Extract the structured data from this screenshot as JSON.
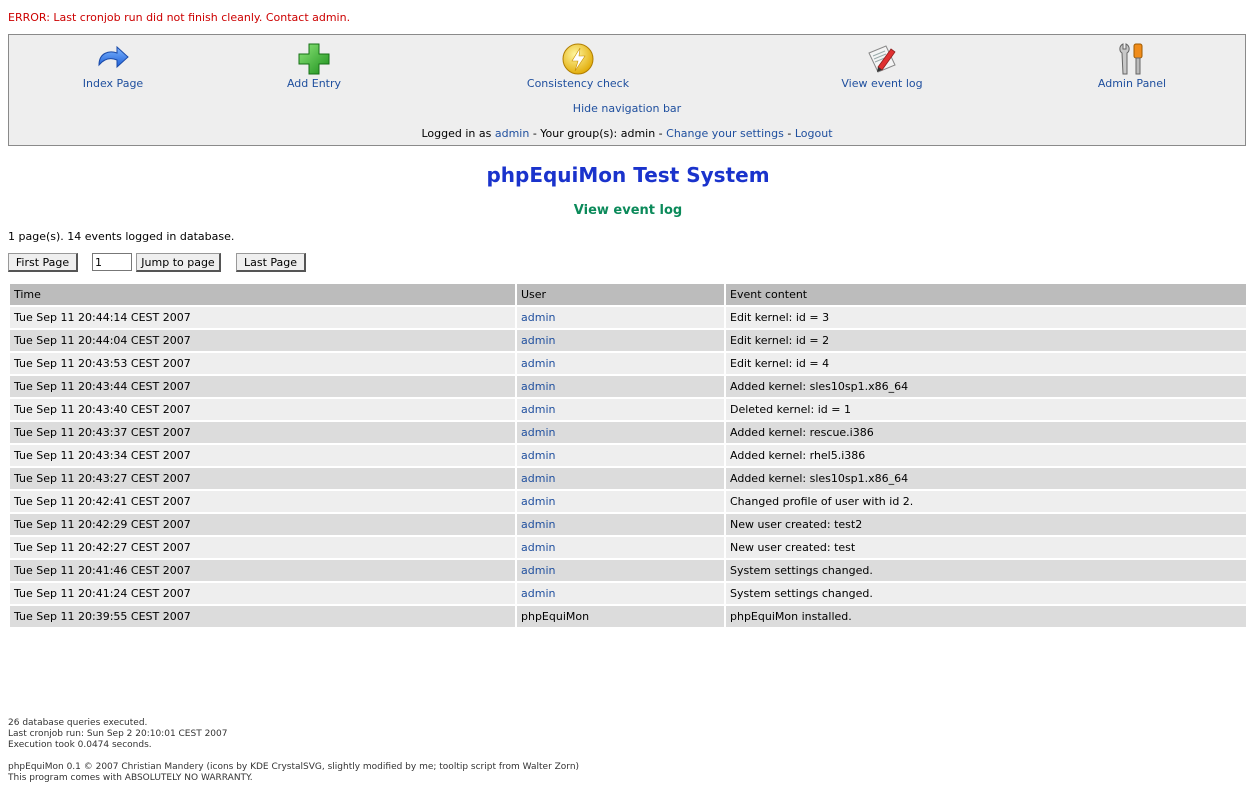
{
  "error": "ERROR: Last cronjob run did not finish cleanly. Contact admin.",
  "nav": {
    "items": [
      {
        "label": "Index Page",
        "icon": "redo-arrow-icon"
      },
      {
        "label": "Add Entry",
        "icon": "green-plus-icon"
      },
      {
        "label": "Consistency check",
        "icon": "lightning-icon"
      },
      {
        "label": "View event log",
        "icon": "document-pen-icon"
      },
      {
        "label": "Admin Panel",
        "icon": "tools-icon"
      }
    ],
    "hide_label": "Hide navigation bar",
    "login": {
      "prefix": "Logged in as",
      "user": "admin",
      "groups_text": "- Your group(s): admin -",
      "settings_link": "Change your settings",
      "sep": "-",
      "logout_link": "Logout"
    }
  },
  "title": "phpEquiMon Test System",
  "heading": "View event log",
  "summary": "1 page(s). 14 events logged in database.",
  "pager": {
    "first_label": "First Page",
    "page_value": "1",
    "jump_label": "Jump to page",
    "last_label": "Last Page"
  },
  "table": {
    "headers": [
      "Time",
      "User",
      "Event content"
    ],
    "rows": [
      {
        "time": "Tue Sep 11 20:44:14 CEST 2007",
        "user": "admin",
        "event": "Edit kernel: id = 3"
      },
      {
        "time": "Tue Sep 11 20:44:04 CEST 2007",
        "user": "admin",
        "event": "Edit kernel: id = 2"
      },
      {
        "time": "Tue Sep 11 20:43:53 CEST 2007",
        "user": "admin",
        "event": "Edit kernel: id = 4"
      },
      {
        "time": "Tue Sep 11 20:43:44 CEST 2007",
        "user": "admin",
        "event": "Added kernel: sles10sp1.x86_64"
      },
      {
        "time": "Tue Sep 11 20:43:40 CEST 2007",
        "user": "admin",
        "event": "Deleted kernel: id = 1"
      },
      {
        "time": "Tue Sep 11 20:43:37 CEST 2007",
        "user": "admin",
        "event": "Added kernel: rescue.i386"
      },
      {
        "time": "Tue Sep 11 20:43:34 CEST 2007",
        "user": "admin",
        "event": "Added kernel: rhel5.i386"
      },
      {
        "time": "Tue Sep 11 20:43:27 CEST 2007",
        "user": "admin",
        "event": "Added kernel: sles10sp1.x86_64"
      },
      {
        "time": "Tue Sep 11 20:42:41 CEST 2007",
        "user": "admin",
        "event": "Changed profile of user with id 2."
      },
      {
        "time": "Tue Sep 11 20:42:29 CEST 2007",
        "user": "admin",
        "event": "New user created: test2"
      },
      {
        "time": "Tue Sep 11 20:42:27 CEST 2007",
        "user": "admin",
        "event": "New user created: test"
      },
      {
        "time": "Tue Sep 11 20:41:46 CEST 2007",
        "user": "admin",
        "event": "System settings changed."
      },
      {
        "time": "Tue Sep 11 20:41:24 CEST 2007",
        "user": "admin",
        "event": "System settings changed."
      },
      {
        "time": "Tue Sep 11 20:39:55 CEST 2007",
        "user": "phpEquiMon",
        "event": "phpEquiMon installed."
      }
    ]
  },
  "footer": {
    "queries": "26 database queries executed.",
    "cronjob": "Last cronjob run: Sun Sep 2 20:10:01 CEST 2007",
    "exec": "Execution took 0.0474 seconds.",
    "credits": "phpEquiMon 0.1   © 2007 Christian Mandery (icons by KDE CrystalSVG, slightly modified by me; tooltip script from Walter Zorn)",
    "warranty": "This program comes with ABSOLUTELY NO WARRANTY."
  },
  "colors": {
    "error": "#cc0000",
    "link": "#1f4f9e",
    "title": "#1a33cc",
    "heading": "#0b8a5a"
  }
}
